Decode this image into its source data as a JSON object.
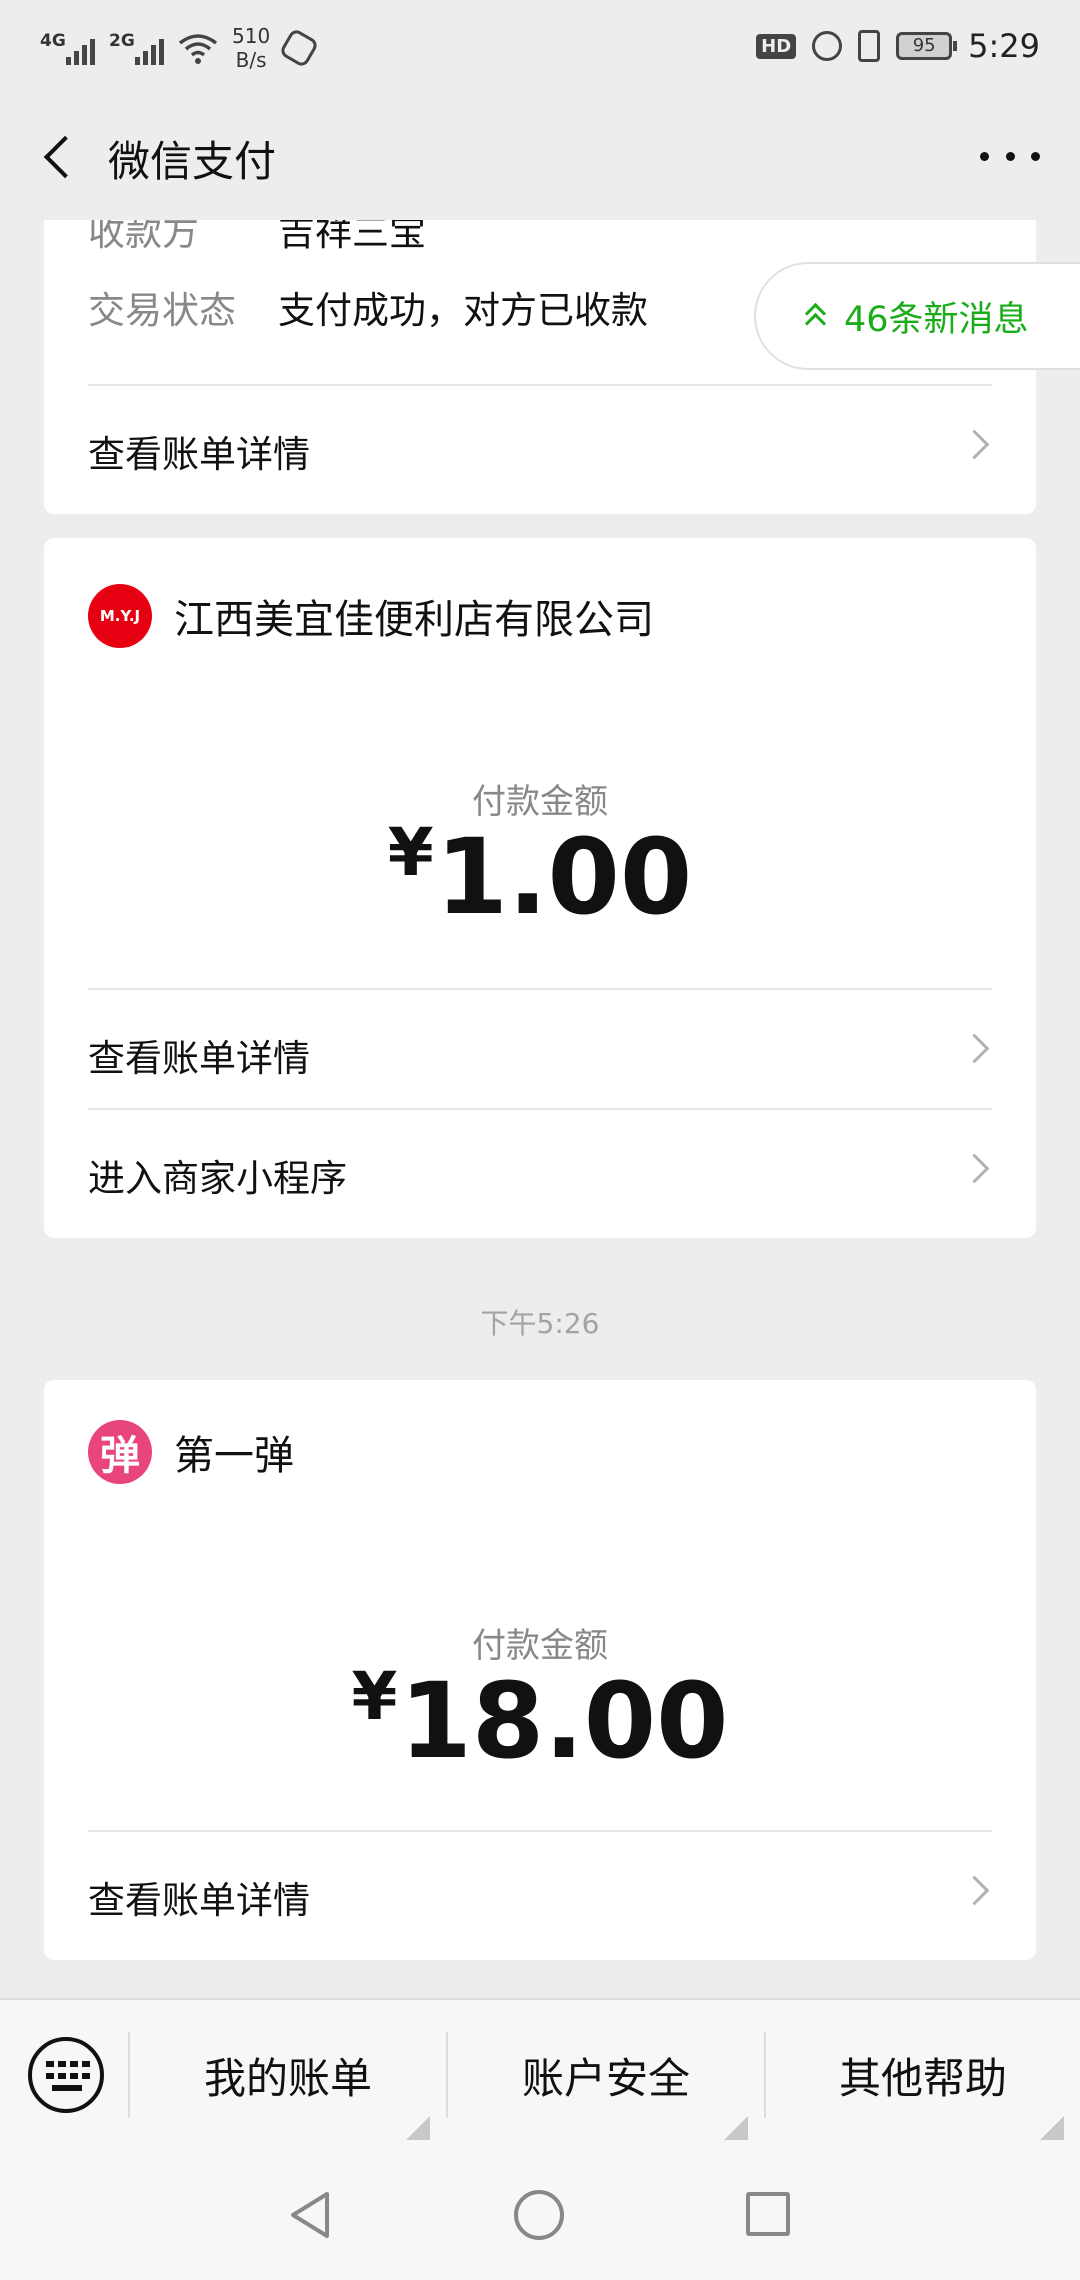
{
  "status_bar": {
    "signal1": "4G",
    "signal2": "2G",
    "net_speed_value": "510",
    "net_speed_unit": "B/s",
    "hd": "HD",
    "battery": "95",
    "time": "5:29"
  },
  "nav": {
    "title": "微信支付"
  },
  "new_messages": "46条新消息",
  "card0": {
    "payee_label": "收款方",
    "payee_value": "吉祥三宝",
    "status_label": "交易状态",
    "status_value": "支付成功，对方已收款",
    "detail_link": "查看账单详情"
  },
  "card1": {
    "merchant": "江西美宜佳便利店有限公司",
    "logo_text": "M.Y.J",
    "amount_label": "付款金额",
    "currency": "¥",
    "amount": "1.00",
    "detail_link": "查看账单详情",
    "mini_program_link": "进入商家小程序"
  },
  "timestamp": "下午5:26",
  "card2": {
    "merchant": "第一弹",
    "logo_text": "弹",
    "amount_label": "付款金额",
    "currency": "¥",
    "amount": "18.00",
    "detail_link": "查看账单详情"
  },
  "bottom_menu": {
    "items": [
      "我的账单",
      "账户安全",
      "其他帮助"
    ]
  },
  "colors": {
    "accent_green": "#1aad19",
    "myj_red": "#e60012",
    "dyd_pink": "#e8457a"
  }
}
